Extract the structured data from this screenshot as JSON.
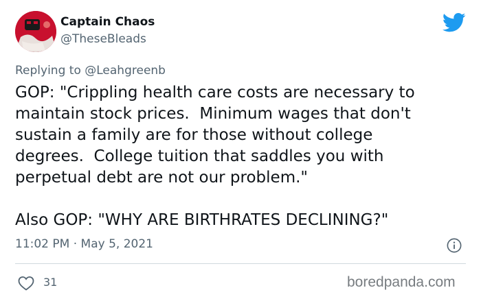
{
  "tweet": {
    "author_name": "Captain Chaos",
    "author_handle": "@TheseBleads",
    "replying_prefix": "Replying to ",
    "replying_to": "@Leahgreenb",
    "text": "GOP: \"Crippling health care costs are necessary to\nmaintain stock prices.  Minimum wages that don't\nsustain a family are for those without college\ndegrees.  College tuition that saddles you with\nperpetual debt are not our problem.\"\n\nAlso GOP: \"WHY ARE BIRTHRATES DECLINING?\"",
    "timestamp": "11:02 PM · May 5, 2021",
    "like_count": "31"
  },
  "watermark": "boredpanda.com",
  "icons": {
    "brand": "twitter-bird-icon",
    "info": "info-icon",
    "like": "heart-icon"
  },
  "colors": {
    "twitter_blue": "#1d9bf0",
    "secondary_text": "#536471",
    "avatar_red": "#c8102e"
  }
}
